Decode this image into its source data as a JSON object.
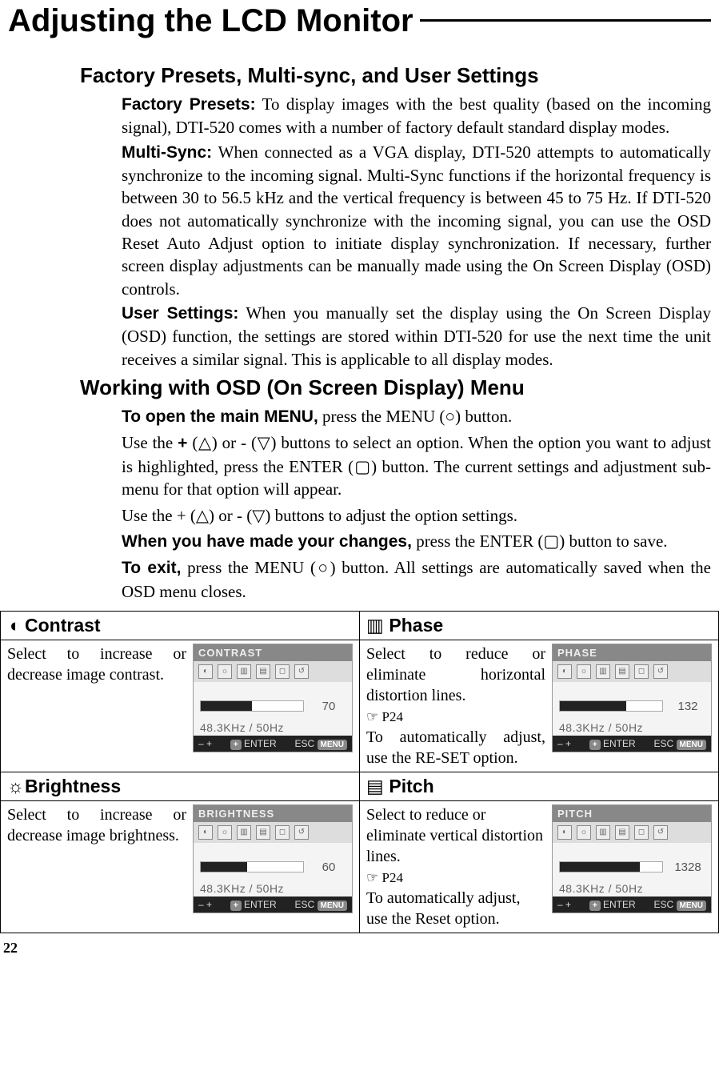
{
  "page": {
    "title": "Adjusting the LCD Monitor",
    "number": "22"
  },
  "section1": {
    "heading": "Factory Presets, Multi-sync, and User Settings",
    "fp_label": "Factory Presets:",
    "fp_text": " To display images with the best quality (based on the incoming signal), DTI-520 comes with a number of factory default standard display modes.",
    "ms_label": "Multi-Sync:",
    "ms_text": " When connected as a VGA display, DTI-520 attempts to automatically synchronize to the incoming signal.  Multi-Sync functions if the horizontal frequency is between 30 to 56.5 kHz and the vertical frequency is between 45 to 75 Hz. If DTI-520 does not automatically synchronize with the incoming signal, you can use the OSD Reset Auto Adjust option to initiate display synchronization.  If necessary, further screen display adjustments can be manually made using the On Screen Display (OSD) controls.",
    "us_label": "User Settings:",
    "us_text": " When you manually set the display using the On Screen Display (OSD) function, the settings are stored within DTI-520 for use the next time the unit receives a similar signal.  This is applicable to all display modes."
  },
  "section2": {
    "heading": "Working with OSD (On Screen Display) Menu",
    "open_label": "To open the main MENU,",
    "open_text": " press the MENU (○) button.",
    "p2a": "Use the ",
    "p2b": " (△) or  -  (▽) buttons to select an option.  When the option you want to adjust is highlighted, press the ENTER (▢) button.  The current settings and adjustment sub-menu for that option will appear.",
    "p3": "Use the + (△) or  -  (▽) buttons to adjust the option settings.",
    "save_label": "When you have made your changes,",
    "save_text": " press the ENTER (▢) button to save.",
    "exit_label": "To exit,",
    "exit_text": " press the MENU (○) button. All settings are automatically saved when the OSD menu closes.",
    "plus": "+"
  },
  "osd": {
    "contrast": {
      "icon": "◐",
      "title": "Contrast",
      "text": "Select to increase or decrease image contrast.",
      "shot_title": "CONTRAST",
      "value": "70",
      "fill": "50%",
      "freq": "48.3KHz  /    50Hz"
    },
    "phase": {
      "icon": "▥",
      "title": "Phase",
      "text1": "Select to reduce or eliminate horizontal distortion lines.",
      "ref": "☞ P24",
      "text2": "To automatically adjust, use the RE-SET option.",
      "shot_title": "PHASE",
      "value": "132",
      "fill": "65%",
      "freq": "48.3KHz  /    50Hz"
    },
    "brightness": {
      "icon": "☼",
      "title": "Brightness",
      "text": "Select to increase or decrease image brightness.",
      "shot_title": "BRIGHTNESS",
      "value": "60",
      "fill": "45%",
      "freq": "48.3KHz  /    50Hz"
    },
    "pitch": {
      "icon": "▤",
      "title": "Pitch",
      "text1": "Select to reduce or eliminate vertical distortion lines.",
      "ref": "☞ P24",
      "text2": "To automatically adjust, use the Reset option.",
      "shot_title": "PITCH",
      "value": "1328",
      "fill": "78%",
      "freq": "48.3KHz  /    50Hz"
    },
    "bottom_left": "– +",
    "enter": "ENTER",
    "esc": "ESC",
    "menu": "MENU",
    "plus_btn": "+"
  }
}
